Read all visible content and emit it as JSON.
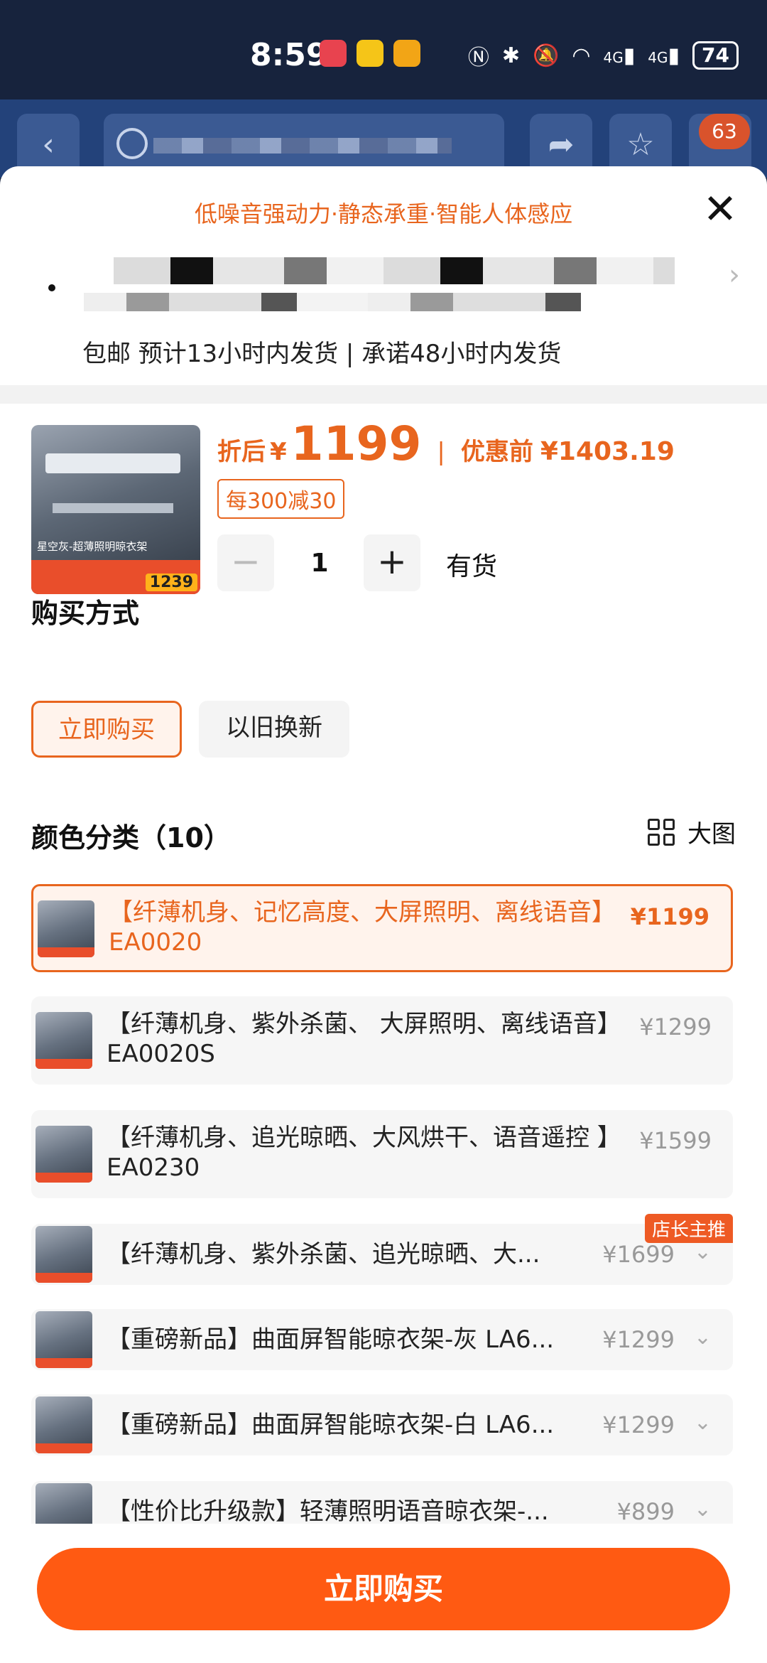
{
  "status_bar": {
    "time": "8:59",
    "battery": "74",
    "network_1": "4G",
    "network_2": "4G"
  },
  "nav": {
    "cart_badge": "63"
  },
  "sheet": {
    "promo": "低噪音强动力·静态承重·智能人体感应",
    "shipping": "包邮 预计13小时内发货 | 承诺48小时内发货"
  },
  "product": {
    "price_label": "折后",
    "currency": "¥",
    "price": "1199",
    "orig_label": "优惠前",
    "orig_price": "¥1403.19",
    "coupon": "每300减30",
    "quantity": "1",
    "stock": "有货",
    "thumb_price": "1239",
    "thumb_text": "星空灰-超薄照明晾衣架"
  },
  "purchase": {
    "title": "购买方式",
    "options": [
      "立即购买",
      "以旧换新"
    ]
  },
  "color": {
    "title": "颜色分类（10）",
    "big_view": "大图",
    "variants": [
      {
        "text": "【纤薄机身、记忆高度、大屏照明、离线语音】EA0020",
        "price": "¥1199"
      },
      {
        "text": "【纤薄机身、紫外杀菌、 大屏照明、离线语音】EA0020S",
        "price": "¥1299"
      },
      {
        "text": "【纤薄机身、追光晾晒、大风烘干、语音遥控 】EA0230",
        "price": "¥1599"
      },
      {
        "text": "【纤薄机身、紫外杀菌、追光晾晒、大...",
        "price": "¥1699",
        "ribbon": "店长主推"
      },
      {
        "text": "【重磅新品】曲面屏智能晾衣架-灰 LA6...",
        "price": "¥1299"
      },
      {
        "text": "【重磅新品】曲面屏智能晾衣架-白 LA6...",
        "price": "¥1299"
      },
      {
        "text": "【性价比升级款】轻薄照明语音晾衣架-...",
        "price": "¥899"
      }
    ]
  },
  "footer": {
    "buy_now": "立即购买"
  },
  "colors": {
    "accent": "#e8651e",
    "button": "#ff5a12"
  }
}
